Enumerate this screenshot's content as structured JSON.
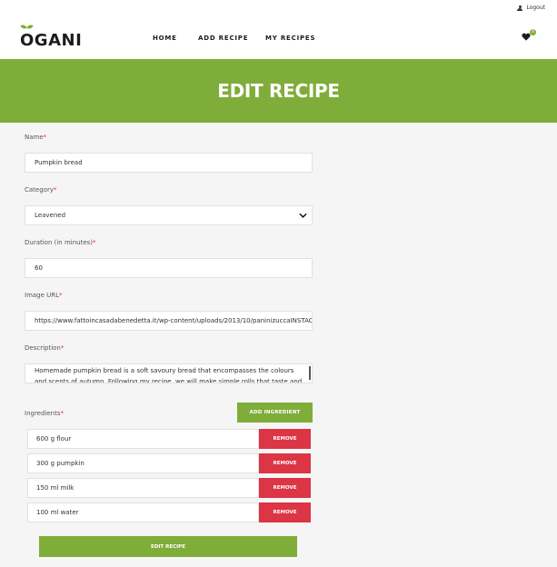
{
  "topbar": {
    "logout_label": "Logout"
  },
  "header": {
    "logo_text": "OGANI",
    "nav": [
      "HOME",
      "ADD RECIPE",
      "MY RECIPES"
    ],
    "cart_count": "0"
  },
  "banner": {
    "title": "EDIT RECIPE"
  },
  "form": {
    "name": {
      "label": "Name",
      "value": "Pumpkin bread"
    },
    "category": {
      "label": "Category",
      "value": "Leavened"
    },
    "duration": {
      "label": "Duration (in minutes)",
      "value": "60"
    },
    "image_url": {
      "label": "Image URL",
      "value": "https://www.fattoincasadabenedetta.it/wp-content/uploads/2013/10/paninizuccaINSTAC"
    },
    "description": {
      "label": "Description",
      "value": "Homemade pumpkin bread is a soft savoury bread that encompasses the colours and scents of autumn. Following my recipe, we will make simple rolls that taste and look like"
    },
    "required_mark": "*",
    "ingredients_label": "Ingredients",
    "add_ingredient_label": "ADD INGREDIENT",
    "ingredients": [
      "600 g flour",
      "300 g pumpkin",
      "150 ml milk",
      "100 ml water"
    ],
    "remove_label": "REMOVE",
    "submit_label": "EDIT RECIPE"
  },
  "colors": {
    "accent": "#7fad39",
    "danger": "#dc3545"
  }
}
